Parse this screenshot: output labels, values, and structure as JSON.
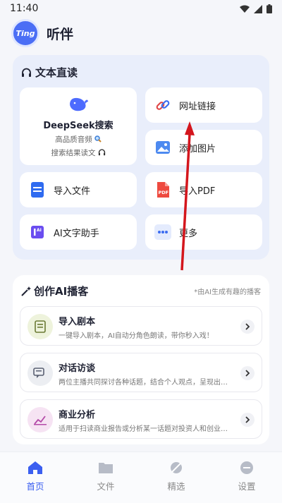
{
  "status": {
    "time": "11:40"
  },
  "app": {
    "logo_text": "Ting",
    "title": "听伴"
  },
  "text_reading": {
    "title": "文本直读",
    "deepseek": {
      "title": "DeepSeek搜索",
      "line1": "高品质音频",
      "line2": "搜索结果读文"
    },
    "items": [
      {
        "label": "网址链接",
        "icon": "link-icon"
      },
      {
        "label": "添加图片",
        "icon": "image-icon"
      },
      {
        "label": "导入文件",
        "icon": "file-icon"
      },
      {
        "label": "导入PDF",
        "icon": "pdf-icon"
      },
      {
        "label": "AI文字助手",
        "icon": "ai-assistant-icon"
      },
      {
        "label": "更多",
        "icon": "more-icon"
      }
    ]
  },
  "ai_podcast": {
    "title": "创作AI播客",
    "note": "*由AI生成有趣的播客",
    "items": [
      {
        "title": "导入剧本",
        "desc": "一键导入剧本，AI自动分角色朗读，带你秒入戏！",
        "icon": "script-icon"
      },
      {
        "title": "对话访谈",
        "desc": "两位主播共同探讨各种话题，结合个人观点，呈现出…",
        "icon": "chat-icon"
      },
      {
        "title": "商业分析",
        "desc": "适用于扫读商业报告或分析某一话题对投资人和创业…",
        "icon": "chart-icon"
      }
    ]
  },
  "nav": [
    {
      "label": "首页",
      "icon": "home-icon",
      "active": true
    },
    {
      "label": "文件",
      "icon": "folder-icon",
      "active": false
    },
    {
      "label": "精选",
      "icon": "featured-icon",
      "active": false
    },
    {
      "label": "设置",
      "icon": "settings-icon",
      "active": false
    }
  ],
  "colors": {
    "accent": "#3b5ff0",
    "annotation": "#d4161d"
  }
}
